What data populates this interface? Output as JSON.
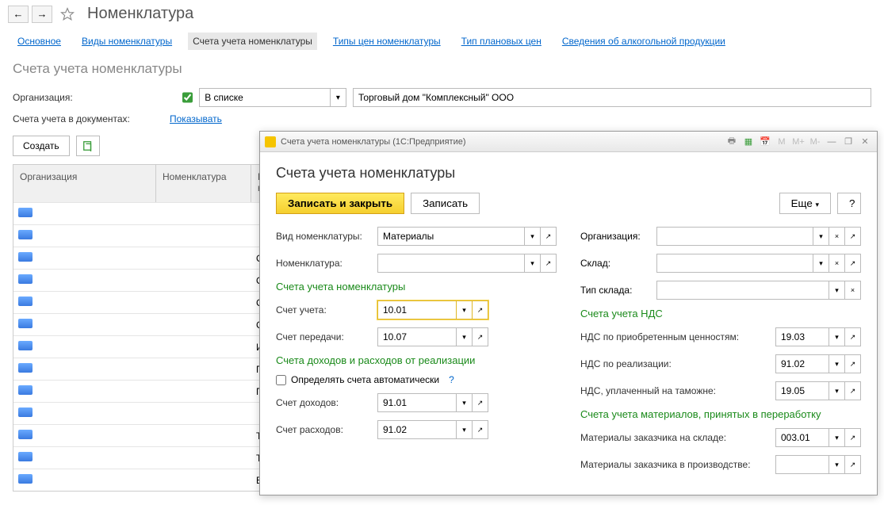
{
  "header": {
    "title": "Номенклатура"
  },
  "tabs": {
    "main": "Основное",
    "types": "Виды номенклатуры",
    "accounts": "Счета учета номенклатуры",
    "price_types": "Типы цен номенклатуры",
    "planned_price_type": "Тип плановых цен",
    "alcohol_info": "Сведения об алкогольной продукции"
  },
  "section": {
    "title": "Счета учета номенклатуры",
    "org_label": "Организация:",
    "filter_mode": "В списке",
    "org_value": "Торговый дом \"Комплексный\" ООО",
    "docs_label": "Счета учета в документах:",
    "docs_link": "Показывать",
    "create_btn": "Создать"
  },
  "table": {
    "h1": "Организация",
    "h2": "Номенклатура",
    "h3": "Вид номенклатуры",
    "rows": [
      {
        "col2": ""
      },
      {
        "col2": ""
      },
      {
        "col2": "Обо"
      },
      {
        "col2": "Обо"
      },
      {
        "col2": "Спе"
      },
      {
        "col2": "Спе"
      },
      {
        "col2": "Инв"
      },
      {
        "col2": "Пол"
      },
      {
        "col2": "Про"
      },
      {
        "col2": ""
      },
      {
        "col2": "Тов"
      },
      {
        "col2": "Тов"
      },
      {
        "col2": "Воз"
      }
    ]
  },
  "dialog": {
    "title": "Счета учета номенклатуры  (1С:Предприятие)",
    "heading": "Счета учета номенклатуры",
    "save_close": "Записать и закрыть",
    "save": "Записать",
    "more": "Еще",
    "help": "?",
    "left": {
      "kind_label": "Вид номенклатуры:",
      "kind_value": "Материалы",
      "nomen_label": "Номенклатура:",
      "nomen_value": "",
      "grp_accounts": "Счета учета номенклатуры",
      "account_label": "Счет учета:",
      "account_value": "10.01",
      "transfer_label": "Счет передачи:",
      "transfer_value": "10.07",
      "grp_income": "Счета доходов и расходов от реализации",
      "auto_check": "Определять счета автоматически",
      "income_label": "Счет доходов:",
      "income_value": "91.01",
      "expense_label": "Счет расходов:",
      "expense_value": "91.02"
    },
    "right": {
      "org_label": "Организация:",
      "warehouse_label": "Склад:",
      "warehouse_type_label": "Тип склада:",
      "grp_vat": "Счета учета НДС",
      "vat_purchased_label": "НДС по приобретенным ценностям:",
      "vat_purchased_value": "19.03",
      "vat_sale_label": "НДС по реализации:",
      "vat_sale_value": "91.02",
      "vat_customs_label": "НДС, уплаченный на таможне:",
      "vat_customs_value": "19.05",
      "grp_materials": "Счета учета материалов, принятых в переработку",
      "mat_stock_label": "Материалы заказчика на складе:",
      "mat_stock_value": "003.01",
      "mat_prod_label": "Материалы заказчика в производстве:"
    }
  }
}
